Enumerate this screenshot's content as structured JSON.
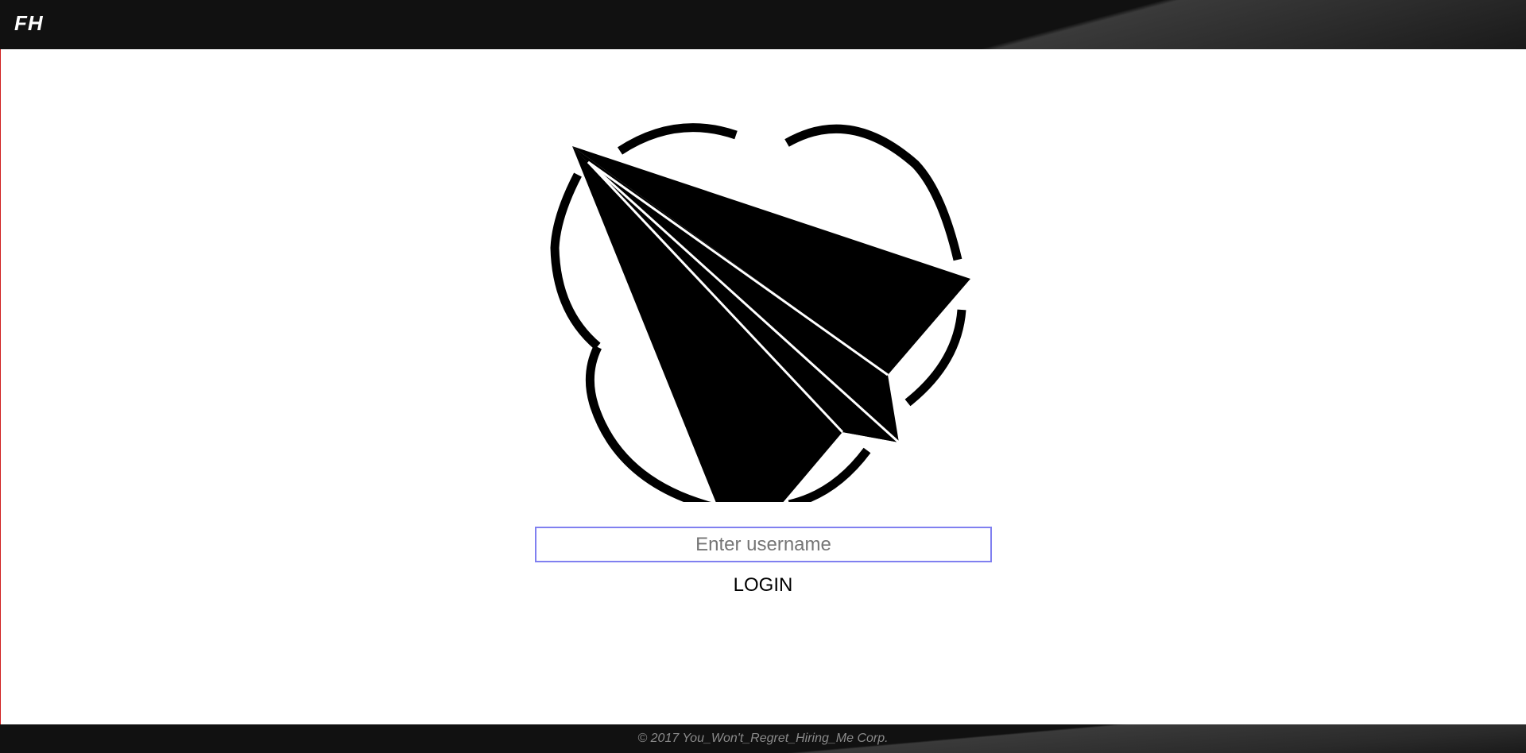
{
  "header": {
    "brand": "FH"
  },
  "main": {
    "logo_icon": "paper-plane-cloud-icon",
    "username_placeholder": "Enter username",
    "username_value": "",
    "login_label": "LOGIN"
  },
  "footer": {
    "copyright": "© 2017 You_Won't_Regret_Hiring_Me Corp."
  },
  "colors": {
    "header_bg": "#111111",
    "input_border": "#8080f0",
    "left_accent": "#d02020"
  }
}
